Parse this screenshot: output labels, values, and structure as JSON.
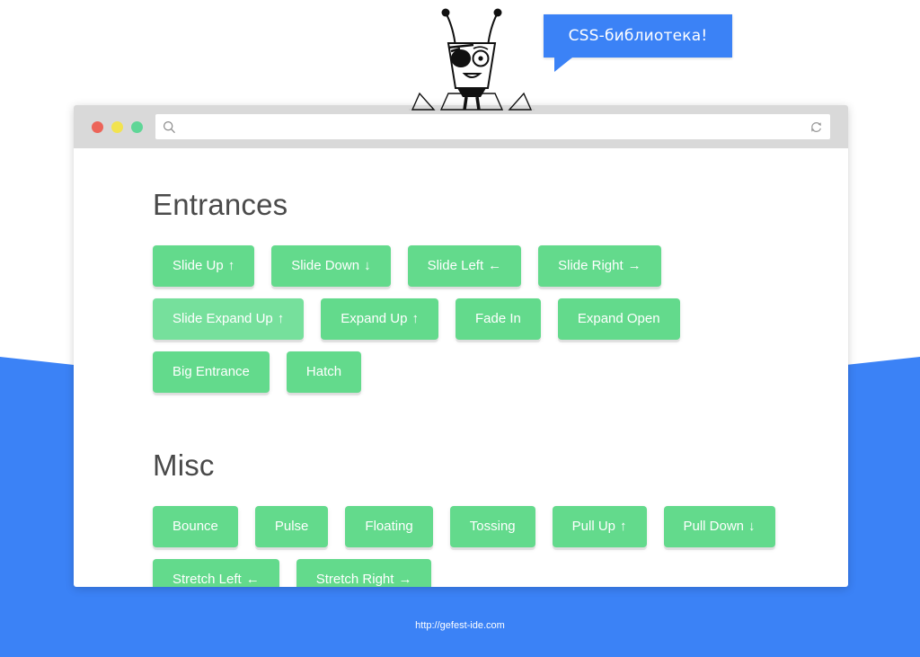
{
  "theme": {
    "blue": "#3b82f6",
    "green": "#63da8c",
    "green_faded": "#76e09c",
    "toolbar_grey": "#d9d9d9",
    "heading_color": "#4a4a4a",
    "page_background": "#ffffff"
  },
  "mascot": {
    "name": "pirate-robot-mascot",
    "alt": "Robot with eyepatch"
  },
  "speech_bubble": {
    "text": "CSS-библиотека!"
  },
  "browser": {
    "traffic_lights": [
      {
        "name": "close",
        "color": "#ec6459"
      },
      {
        "name": "minimize",
        "color": "#f2e34f"
      },
      {
        "name": "maximize",
        "color": "#5fd697"
      }
    ],
    "address": {
      "value": "",
      "placeholder": "",
      "search_icon": "search-icon",
      "reload_icon": "reload-icon"
    }
  },
  "sections": [
    {
      "id": "entrances",
      "title": "Entrances",
      "buttons": [
        {
          "label": "Slide Up",
          "arrow": "↑",
          "faded": false
        },
        {
          "label": "Slide Down",
          "arrow": "↓",
          "faded": false
        },
        {
          "label": "Slide Left",
          "arrow": "←",
          "faded": false
        },
        {
          "label": "Slide Right",
          "arrow": "→",
          "faded": false
        },
        {
          "label": "Slide Expand Up",
          "arrow": "↑",
          "faded": true
        },
        {
          "label": "Expand Up",
          "arrow": "↑",
          "faded": false
        },
        {
          "label": "Fade In",
          "arrow": "",
          "faded": false
        },
        {
          "label": "Expand Open",
          "arrow": "",
          "faded": false
        },
        {
          "label": "Big Entrance",
          "arrow": "",
          "faded": false
        },
        {
          "label": "Hatch",
          "arrow": "",
          "faded": false
        }
      ]
    },
    {
      "id": "misc",
      "title": "Misc",
      "buttons": [
        {
          "label": "Bounce",
          "arrow": "",
          "faded": false
        },
        {
          "label": "Pulse",
          "arrow": "",
          "faded": false
        },
        {
          "label": "Floating",
          "arrow": "",
          "faded": false
        },
        {
          "label": "Tossing",
          "arrow": "",
          "faded": false
        },
        {
          "label": "Pull Up",
          "arrow": "↑",
          "faded": false
        },
        {
          "label": "Pull Down",
          "arrow": "↓",
          "faded": false
        },
        {
          "label": "Stretch Left",
          "arrow": "←",
          "faded": false
        },
        {
          "label": "Stretch Right",
          "arrow": "→",
          "faded": false
        }
      ]
    }
  ],
  "footer": {
    "url": "http://gefest-ide.com"
  }
}
